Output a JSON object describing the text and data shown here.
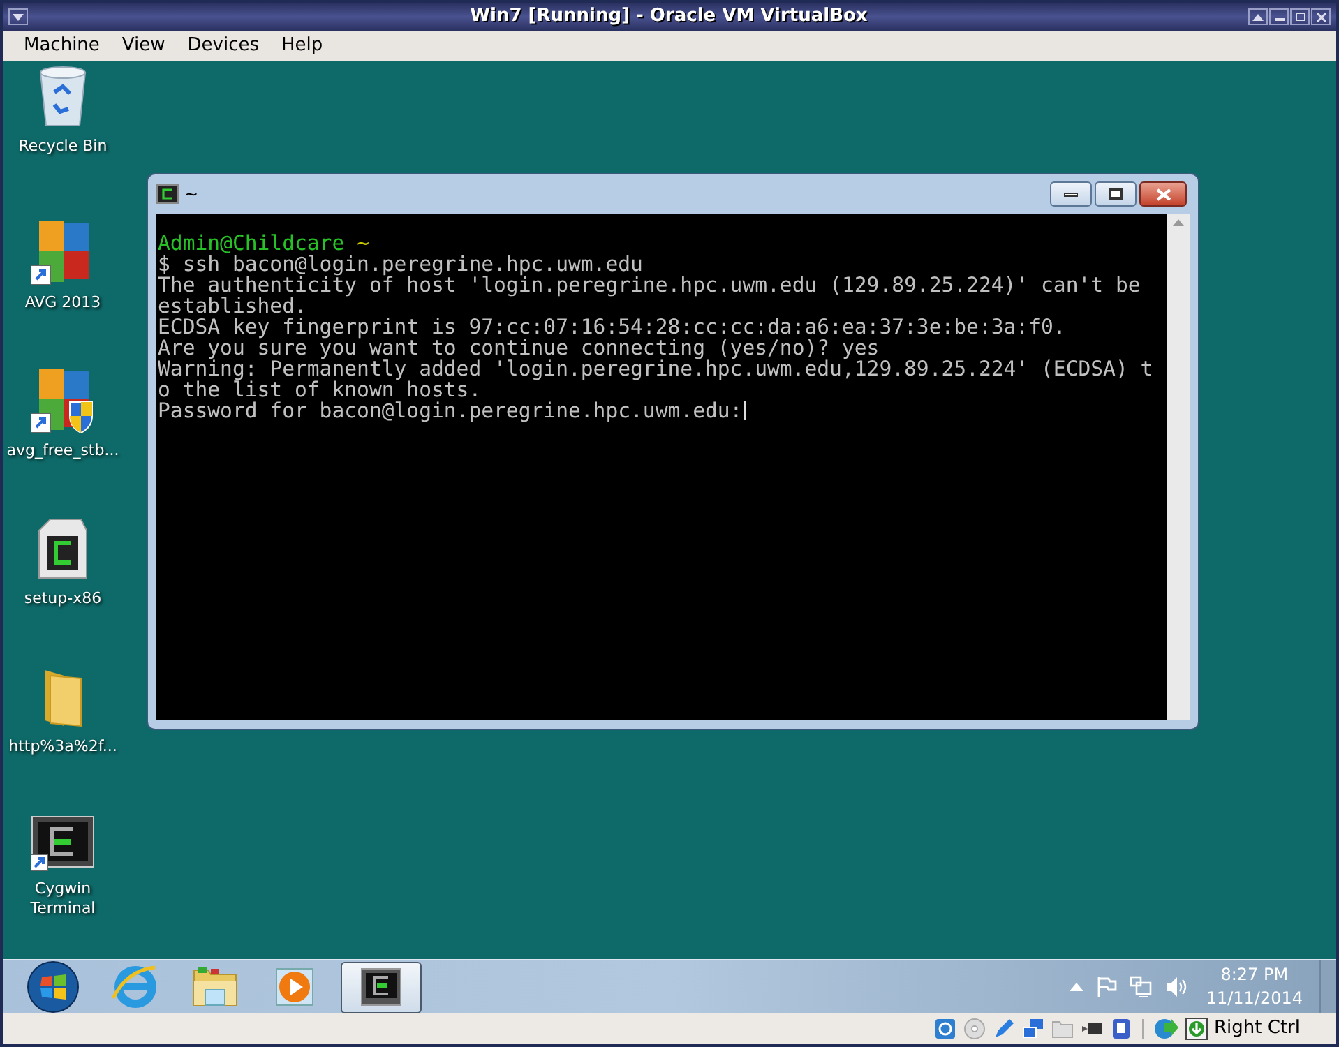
{
  "window": {
    "title": "Win7 [Running] - Oracle VM VirtualBox"
  },
  "menu": [
    "Machine",
    "View",
    "Devices",
    "Help"
  ],
  "desktop_icons": [
    {
      "kind": "recycle",
      "label": "Recycle Bin"
    },
    {
      "kind": "avg",
      "label": "AVG 2013"
    },
    {
      "kind": "avgsetup",
      "label": "avg_free_stb..."
    },
    {
      "kind": "setup",
      "label": "setup-x86"
    },
    {
      "kind": "folder",
      "label": "http%3a%2f..."
    },
    {
      "kind": "cygwin",
      "label": "Cygwin Terminal"
    }
  ],
  "terminal": {
    "title": "~",
    "prompt_user": "Admin@Childcare",
    "prompt_path": "~",
    "lines": [
      "$ ssh bacon@login.peregrine.hpc.uwm.edu",
      "The authenticity of host 'login.peregrine.hpc.uwm.edu (129.89.25.224)' can't be",
      "established.",
      "ECDSA key fingerprint is 97:cc:07:16:54:28:cc:cc:da:a6:ea:37:3e:be:3a:f0.",
      "Are you sure you want to continue connecting (yes/no)? yes",
      "Warning: Permanently added 'login.peregrine.hpc.uwm.edu,129.89.25.224' (ECDSA) t",
      "o the list of known hosts.",
      "Password for bacon@login.peregrine.hpc.uwm.edu:"
    ]
  },
  "taskbar": [
    {
      "kind": "start",
      "selected": false
    },
    {
      "kind": "ie",
      "selected": false
    },
    {
      "kind": "explorer",
      "selected": false
    },
    {
      "kind": "media",
      "selected": false
    },
    {
      "kind": "cygwin",
      "selected": true
    }
  ],
  "tray": {
    "time": "8:27 PM",
    "date": "11/11/2014"
  },
  "status_bar": {
    "host_key": "Right Ctrl"
  }
}
